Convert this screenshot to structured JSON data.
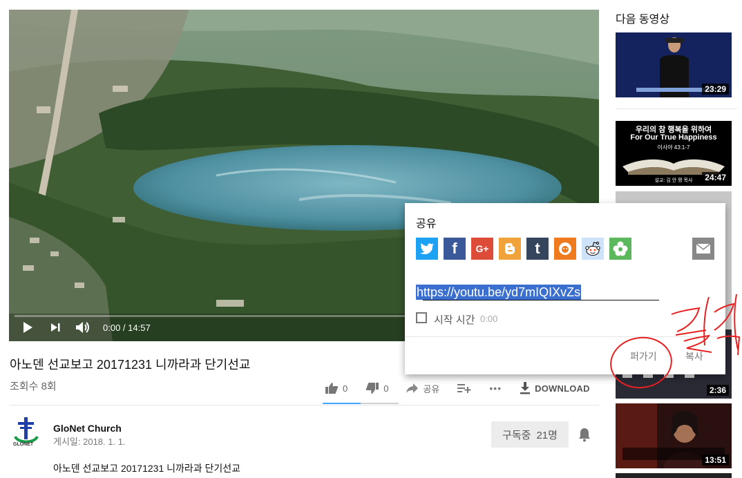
{
  "player": {
    "time": "0:00 / 14:57",
    "icons": {
      "play": "play-icon",
      "next": "next-icon",
      "volume": "volume-icon"
    }
  },
  "video": {
    "title": "아노덴 선교보고 20171231 니까라과 단기선교",
    "views": "조회수 8회",
    "like_count": "0",
    "dislike_count": "0",
    "share_label": "공유",
    "more_label": "•••",
    "download_label": "DOWNLOAD"
  },
  "channel": {
    "name": "GloNet Church",
    "published": "게시일: 2018. 1. 1.",
    "avatar_text": "GLONET",
    "subscribe_label": "구독중",
    "subscriber_count": "21명",
    "description": "아노덴 선교보고 20171231 니까라과 단기선교"
  },
  "sidebar": {
    "heading": "다음 동영상",
    "items": [
      {
        "duration": "23:29"
      },
      {
        "duration": "24:47",
        "title_ko": "우리의 참 행복을 위하여",
        "title_en": "For Our True Happiness",
        "verse": "이사야 43:1-7",
        "preacher": "설교: 김 안 평 목사"
      },
      {
        "duration": "2:36"
      },
      {
        "duration": "13:51"
      }
    ]
  },
  "share": {
    "title": "공유",
    "url": "https://youtu.be/yd7mIQIXvZs",
    "start_time_label": "시작 시간",
    "start_time_value": "0:00",
    "embed_label": "퍼가기",
    "copy_label": "복사",
    "services": [
      "twitter-icon",
      "facebook-icon",
      "google-plus-icon",
      "blogger-icon",
      "tumblr-icon",
      "reddit-alien-icon",
      "reddit-icon",
      "cafe-icon",
      "email-icon"
    ],
    "colors": {
      "twitter": "#1da1f2",
      "facebook": "#3b5998",
      "google_plus": "#dd4b39",
      "blogger": "#f0a33a",
      "tumblr": "#35465c",
      "orange": "#f07a1e",
      "reddit": "#cee3f8",
      "cafe": "#5cb85c",
      "email": "#888888"
    }
  },
  "annotation": {
    "text": "클릭",
    "color": "#e52020"
  }
}
